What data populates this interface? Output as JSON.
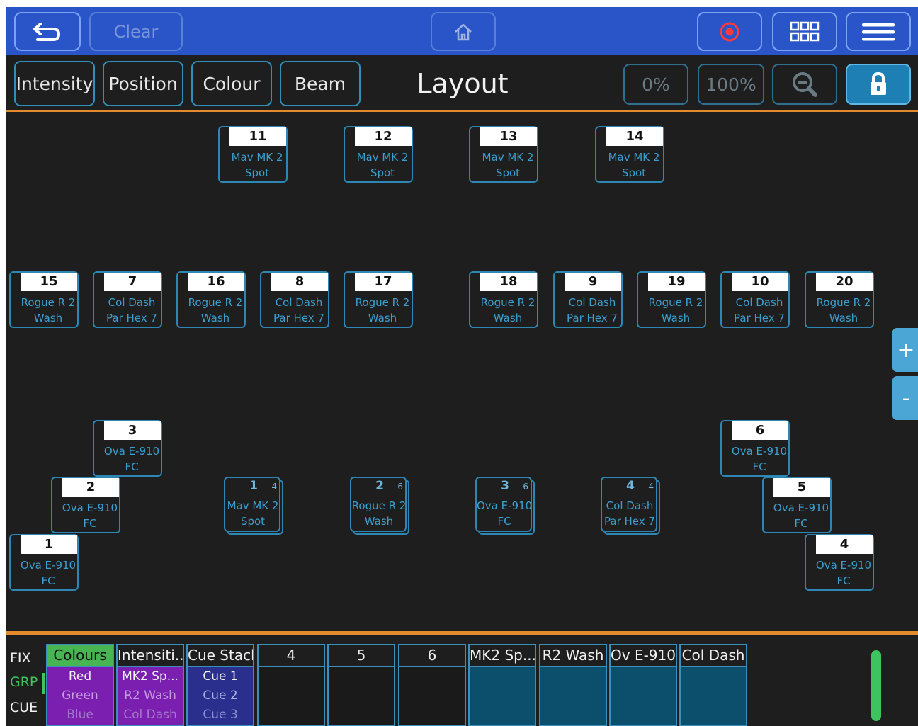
{
  "topbar": {
    "clear_label": "Clear",
    "accent_color": "#2a55c8"
  },
  "subbar": {
    "tabs": [
      "Intensity",
      "Position",
      "Colour",
      "Beam"
    ],
    "title": "Layout",
    "zero_label": "0%",
    "full_label": "100%"
  },
  "fixtures": [
    {
      "num": "11",
      "line1": "Mav MK 2",
      "line2": "Spot"
    },
    {
      "num": "12",
      "line1": "Mav MK 2",
      "line2": "Spot"
    },
    {
      "num": "13",
      "line1": "Mav MK 2",
      "line2": "Spot"
    },
    {
      "num": "14",
      "line1": "Mav MK 2",
      "line2": "Spot"
    },
    {
      "num": "15",
      "line1": "Rogue R 2",
      "line2": "Wash"
    },
    {
      "num": "7",
      "line1": "Col Dash",
      "line2": "Par Hex 7"
    },
    {
      "num": "16",
      "line1": "Rogue R 2",
      "line2": "Wash"
    },
    {
      "num": "8",
      "line1": "Col Dash",
      "line2": "Par Hex 7"
    },
    {
      "num": "17",
      "line1": "Rogue R 2",
      "line2": "Wash"
    },
    {
      "num": "18",
      "line1": "Rogue R 2",
      "line2": "Wash"
    },
    {
      "num": "9",
      "line1": "Col Dash",
      "line2": "Par Hex 7"
    },
    {
      "num": "19",
      "line1": "Rogue R 2",
      "line2": "Wash"
    },
    {
      "num": "10",
      "line1": "Col Dash",
      "line2": "Par Hex 7"
    },
    {
      "num": "20",
      "line1": "Rogue R 2",
      "line2": "Wash"
    },
    {
      "num": "3",
      "line1": "Ova E-910",
      "line2": "FC"
    },
    {
      "num": "2",
      "line1": "Ova E-910",
      "line2": "FC"
    },
    {
      "num": "1",
      "line1": "Ova E-910",
      "line2": "FC"
    },
    {
      "num": "6",
      "line1": "Ova E-910",
      "line2": "FC"
    },
    {
      "num": "5",
      "line1": "Ova E-910",
      "line2": "FC"
    },
    {
      "num": "4",
      "line1": "Ova E-910",
      "line2": "FC"
    }
  ],
  "groups": [
    {
      "num": "1",
      "count": "4",
      "line1": "Mav MK 2",
      "line2": "Spot"
    },
    {
      "num": "2",
      "count": "6",
      "line1": "Rogue R 2",
      "line2": "Wash"
    },
    {
      "num": "3",
      "count": "6",
      "line1": "Ova E-910",
      "line2": "FC"
    },
    {
      "num": "4",
      "count": "4",
      "line1": "Col Dash",
      "line2": "Par Hex 7"
    }
  ],
  "zoom": {
    "plus": "+",
    "minus": "-"
  },
  "palette": {
    "modes": [
      "FIX",
      "GRP",
      "CUE"
    ],
    "active_mode": "GRP",
    "headers": [
      "Colours",
      "Intensiti...",
      "Cue Stack",
      "4",
      "5",
      "6",
      "MK2 Sp...",
      "R2 Wash",
      "Ov E-910",
      "Col Dash"
    ],
    "colours_items": [
      "Red",
      "Green",
      "Blue"
    ],
    "intensity_items": [
      "MK2 Sp...",
      "R2 Wash",
      "Col Dash"
    ],
    "cue_items": [
      "Cue 1",
      "Cue 2",
      "Cue 3"
    ]
  }
}
